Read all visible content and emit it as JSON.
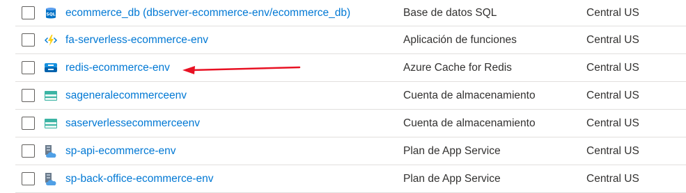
{
  "resources": [
    {
      "name": "ecommerce_db (dbserver-ecommerce-env/ecommerce_db)",
      "type": "Base de datos SQL",
      "location": "Central US",
      "icon": "sql-database-icon"
    },
    {
      "name": "fa-serverless-ecommerce-env",
      "type": "Aplicación de funciones",
      "location": "Central US",
      "icon": "function-app-icon"
    },
    {
      "name": "redis-ecommerce-env",
      "type": "Azure Cache for Redis",
      "location": "Central US",
      "icon": "redis-cache-icon"
    },
    {
      "name": "sageneralecommerceenv",
      "type": "Cuenta de almacenamiento",
      "location": "Central US",
      "icon": "storage-account-icon"
    },
    {
      "name": "saserverlessecommerceenv",
      "type": "Cuenta de almacenamiento",
      "location": "Central US",
      "icon": "storage-account-icon"
    },
    {
      "name": "sp-api-ecommerce-env",
      "type": "Plan de App Service",
      "location": "Central US",
      "icon": "app-service-plan-icon"
    },
    {
      "name": "sp-back-office-ecommerce-env",
      "type": "Plan de App Service",
      "location": "Central US",
      "icon": "app-service-plan-icon"
    }
  ],
  "colors": {
    "link": "#0078d4",
    "annotation_arrow": "#e81123"
  }
}
